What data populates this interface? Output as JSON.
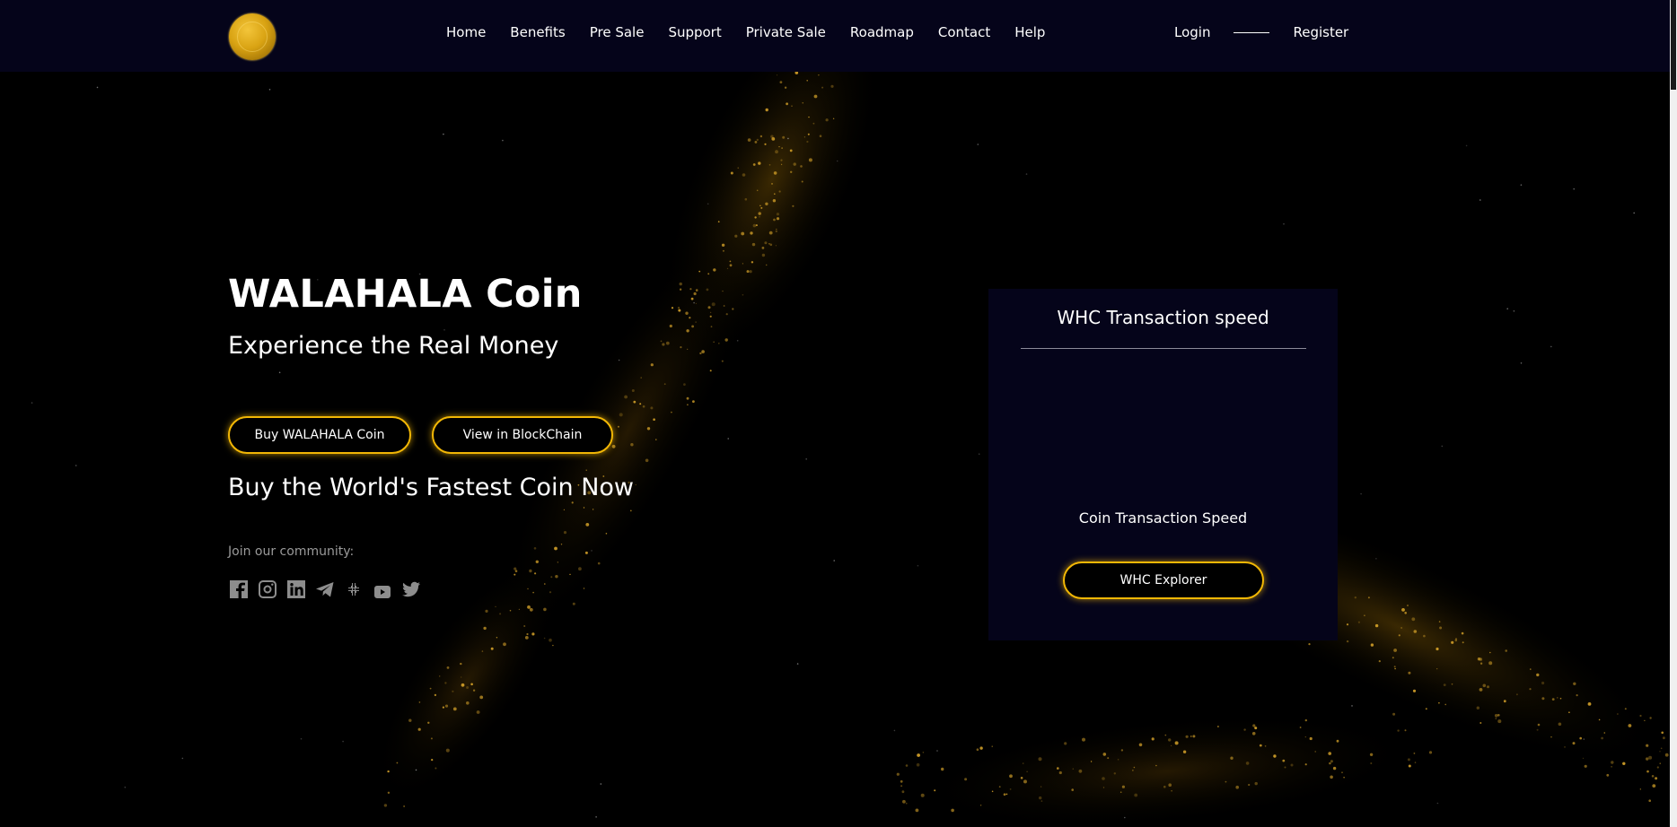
{
  "nav": {
    "links": [
      "Home",
      "Benefits",
      "Pre Sale",
      "Support",
      "Private Sale",
      "Roadmap",
      "Contact",
      "Help"
    ],
    "login": "Login",
    "register": "Register"
  },
  "hero": {
    "title": "WALAHALA Coin",
    "subtitle": "Experience the Real Money",
    "buy_button": "Buy WALAHALA Coin",
    "view_button": "View in BlockChain",
    "tagline": "Buy the World's Fastest Coin Now",
    "community_label": "Join our community:",
    "socials": [
      "facebook-icon",
      "instagram-icon",
      "linkedin-icon",
      "telegram-icon",
      "slack-icon",
      "youtube-icon",
      "twitter-icon"
    ]
  },
  "panel": {
    "title": "WHC Transaction speed",
    "caption": "Coin Transaction Speed",
    "explorer_button": "WHC Explorer"
  },
  "colors": {
    "accent": "#f2b705",
    "nav_bg": "#05041a",
    "page_bg": "#000000"
  }
}
